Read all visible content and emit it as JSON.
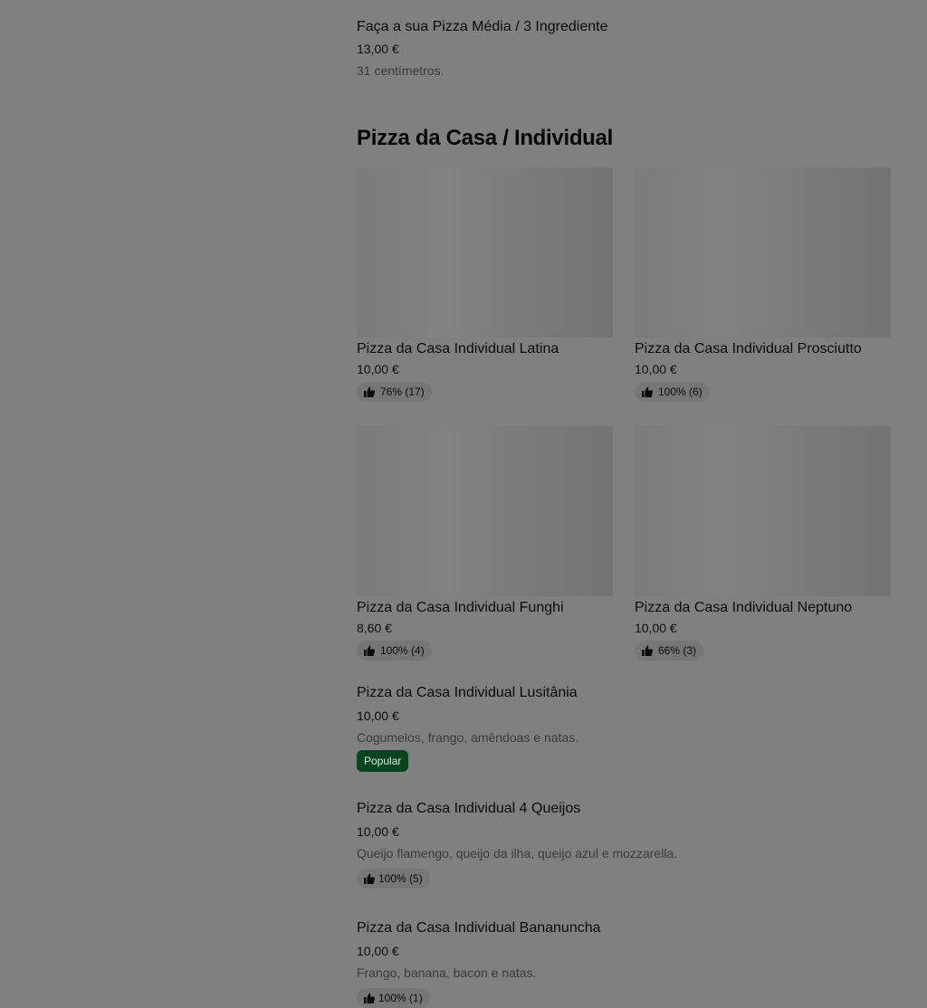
{
  "top_item": {
    "title": "Faça a sua Pizza Média / 3 Ingrediente",
    "price": "13,00 €",
    "desc": "31 centímetros."
  },
  "section": {
    "title": "Pizza da Casa / Individual"
  },
  "cards": [
    {
      "title": "Pizza da Casa Individual Latina",
      "price": "10,00 €",
      "rating": "76% (17)"
    },
    {
      "title": "Pizza da Casa Individual Prosciutto",
      "price": "10,00 €",
      "rating": "100% (6)"
    },
    {
      "title": "Pizza da Casa Individual Funghi",
      "price": "8,60 €",
      "rating": "100% (4)"
    },
    {
      "title": "Pizza da Casa Individual Neptuno",
      "price": "10,00 €",
      "rating": "66% (3)"
    }
  ],
  "list_items": [
    {
      "title": "Pizza da Casa Individual Lusitânia",
      "price": "10,00 €",
      "desc": "Cogumelos, frango, amêndoas e natas.",
      "badge": "Popular"
    },
    {
      "title": "Pizza da Casa Individual 4 Queijos",
      "price": "10,00 €",
      "desc": "Queijo flamengo, queijo da ilha, queijo azul e mozzarella.",
      "rating": "100% (5)"
    },
    {
      "title": "Pizza da Casa Individual Bananuncha",
      "price": "10,00 €",
      "desc": "Frango, banana, bacon e natas.",
      "rating": "100% (1)"
    }
  ],
  "colors": {
    "overlay_bg": "#808080",
    "popular_badge": "#07451f"
  },
  "icons": {
    "rating": "thumbs-up-icon"
  }
}
